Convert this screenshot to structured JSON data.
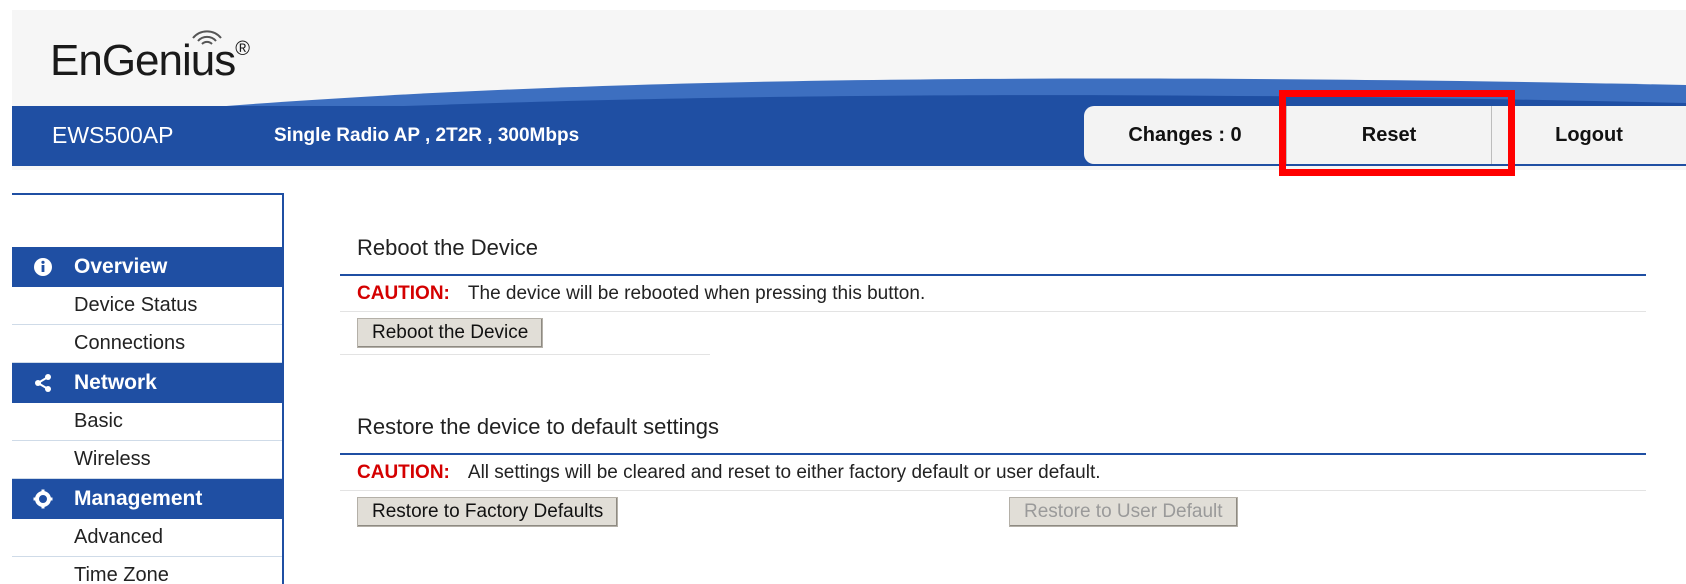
{
  "header": {
    "logo": "EnGenius",
    "logo_mark": "®",
    "model": "EWS500AP",
    "description": "Single Radio AP , 2T2R , 300Mbps",
    "changes_label": "Changes : 0",
    "reset_label": "Reset",
    "logout_label": "Logout"
  },
  "colors": {
    "brand_blue": "#1f4fa3",
    "caution_red": "#d40000",
    "highlight": "#ff0000"
  },
  "sidebar": {
    "sections": [
      {
        "label": "Overview",
        "icon": "info-icon",
        "items": [
          "Device Status",
          "Connections"
        ]
      },
      {
        "label": "Network",
        "icon": "share-icon",
        "items": [
          "Basic",
          "Wireless"
        ]
      },
      {
        "label": "Management",
        "icon": "gear-icon",
        "items": [
          "Advanced",
          "Time Zone"
        ]
      }
    ]
  },
  "main": {
    "reboot": {
      "title": "Reboot the Device",
      "caution_label": "CAUTION:",
      "caution_text": "The device will be rebooted when pressing this button.",
      "button": "Reboot the Device"
    },
    "restore": {
      "title": "Restore the device to default settings",
      "caution_label": "CAUTION:",
      "caution_text": "All settings will be cleared and reset to either factory default or user default.",
      "factory_button": "Restore to Factory Defaults",
      "user_button": "Restore to User Default"
    }
  }
}
